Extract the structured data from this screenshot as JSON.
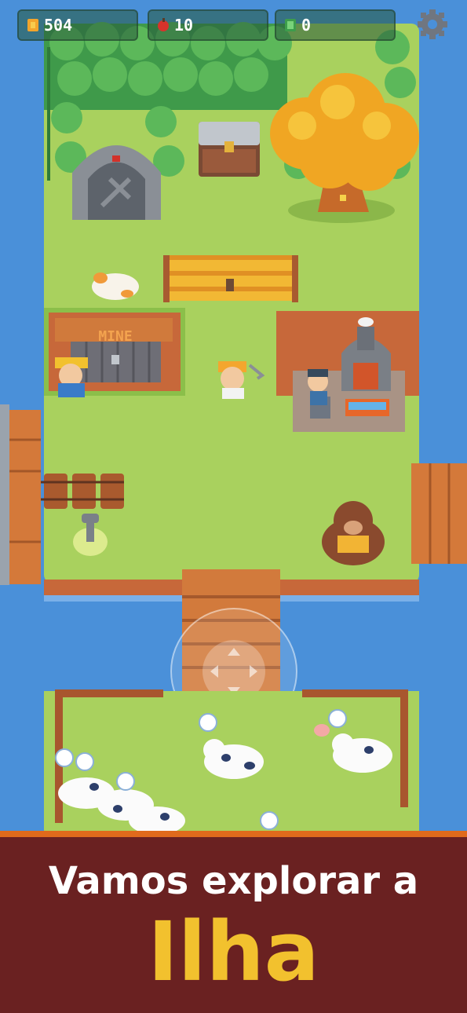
{
  "hud": {
    "gold_count": "504",
    "apple_count": "10",
    "gem_count": "0",
    "gold_icon": "gold-coin-icon",
    "apple_icon": "apple-icon",
    "gem_icon": "green-gem-icon",
    "settings_icon": "gear-icon"
  },
  "world": {
    "mine_sign": "MINE"
  },
  "banner": {
    "line1": "Vamos explorar a",
    "line2": "Ilha"
  },
  "colors": {
    "grass": "#a8d060",
    "water": "#4a90d9",
    "banner_bg": "#6a2121",
    "banner_accent": "#e06a1c",
    "title_yellow": "#f2c12e"
  }
}
